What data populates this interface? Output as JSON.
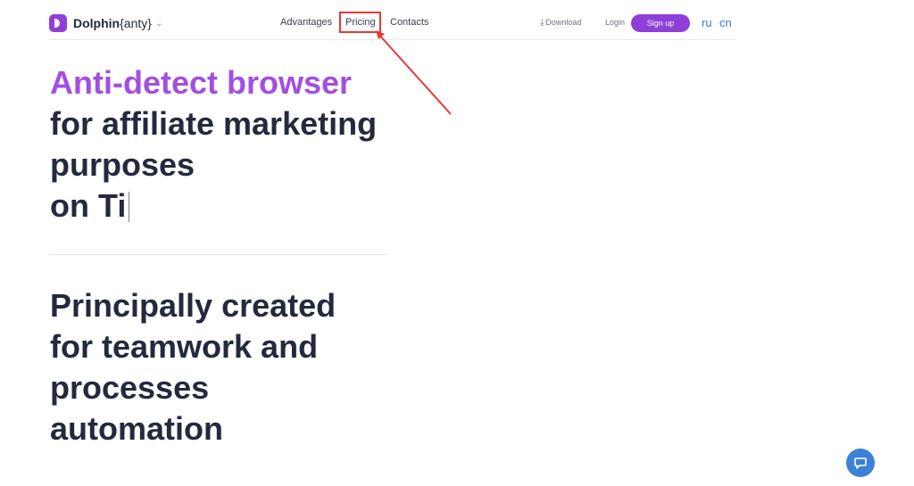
{
  "header": {
    "brand": {
      "name": "Dolphin",
      "suffix": "{anty}",
      "icon": "dolphin-logo-icon"
    },
    "nav": [
      {
        "label": "Advantages"
      },
      {
        "label": "Pricing"
      },
      {
        "label": "Contacts"
      }
    ],
    "download_label": "Download",
    "login_label": "Login",
    "signup_label": "Sign up",
    "languages": [
      "ru",
      "cn"
    ]
  },
  "hero": {
    "accent_line": "Anti-detect browser",
    "lines": [
      "for affiliate marketing",
      "purposes",
      "on Ti"
    ]
  },
  "section2": {
    "lines": [
      "Principally created",
      "for teamwork and",
      "processes",
      "automation"
    ]
  },
  "colors": {
    "accent": "#a14fe0",
    "brand": "#8e3fd8",
    "annotation": "#e53935",
    "chat": "#3b82d6"
  }
}
